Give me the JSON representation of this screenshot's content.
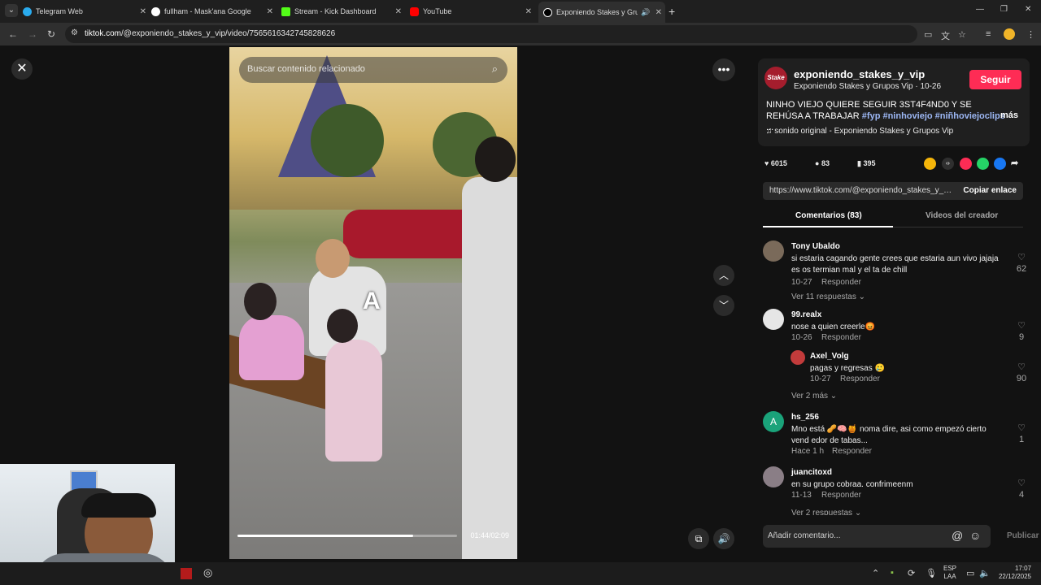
{
  "browser": {
    "tabs": [
      {
        "label": "Telegram Web",
        "color": "#2aabee"
      },
      {
        "label": "fullham - Mask'ana Google",
        "color": "#ffffff"
      },
      {
        "label": "Stream - Kick Dashboard",
        "color": "#53fc18"
      },
      {
        "label": "YouTube",
        "color": "#ff0000"
      },
      {
        "label": "Exponiendo Stakes y Grupos",
        "color": "#ffffff"
      }
    ],
    "url_host": "tiktok.com",
    "url_path": "/@exponiendo_stakes_y_vip/video/7565616342745828626"
  },
  "video": {
    "search_placeholder": "Buscar contenido relacionado",
    "overlay_letter": "A",
    "time": "01:44/02:09",
    "progress": 0.8
  },
  "post": {
    "author": "exponiendo_stakes_y_vip",
    "avatar_text": "Stake",
    "subtitle": "Exponiendo Stakes y Grupos Vip · 10-26",
    "follow_label": "Seguir",
    "caption": "NINHO VIEJO QUIERE SEGUIR 3ST4F4ND0 Y SE REHÚSA A TRABAJAR ",
    "hashtags": "#fyp #ninhoviejo #niñhoviejoclips",
    "ellipsis": " ...",
    "more_label": "más",
    "sound": "sonido original - Exponiendo Stakes y Grupos Vip",
    "likes": "6015",
    "comments": "83",
    "saves": "395",
    "link": "https://www.tiktok.com/@exponiendo_stakes_y_vip...",
    "copy_label": "Copiar enlace",
    "tab_comments": "Comentarios (83)",
    "tab_creator": "Videos del creador"
  },
  "comments": [
    {
      "user": "Tony Ubaldo",
      "text": "si estaria cagando gente crees que estaria aun vivo jajaja es os termian mal y el ta de chill",
      "date": "10-27",
      "reply": "Responder",
      "likes": "62",
      "more": "Ver 11 respuestas",
      "avatar": "#7a6a5a"
    },
    {
      "user": "99.realx",
      "text": "nose a quien creerle😡",
      "date": "10-26",
      "reply": "Responder",
      "likes": "9",
      "avatar": "#e6e6e6"
    },
    {
      "user": "Axel_Volg",
      "text": "pagas y regresas 🥲",
      "date": "10-27",
      "reply": "Responder",
      "likes": "90",
      "more": "Ver 2 más",
      "avatar": "#c23b3b"
    },
    {
      "user": "hs_256",
      "text": "Mno está 🥜🧠🍯 noma dire, asi como empezó cierto vend edor de tabas...",
      "date": "Hace 1 h",
      "reply": "Responder",
      "likes": "1",
      "avatar": "#1aa37a",
      "avatar_letter": "A"
    },
    {
      "user": "juancitoxd",
      "text": "en su grupo cobraa. confrimeenm",
      "date": "11-13",
      "reply": "Responder",
      "likes": "4",
      "more": "Ver 2 respuestas",
      "avatar": "#8a7e86"
    }
  ],
  "composer": {
    "placeholder": "Añadir comentario...",
    "publish": "Publicar"
  },
  "taskbar": {
    "lang_top": "ESP",
    "lang_bottom": "LAA",
    "time": "17:07",
    "date": "22/12/2025"
  }
}
